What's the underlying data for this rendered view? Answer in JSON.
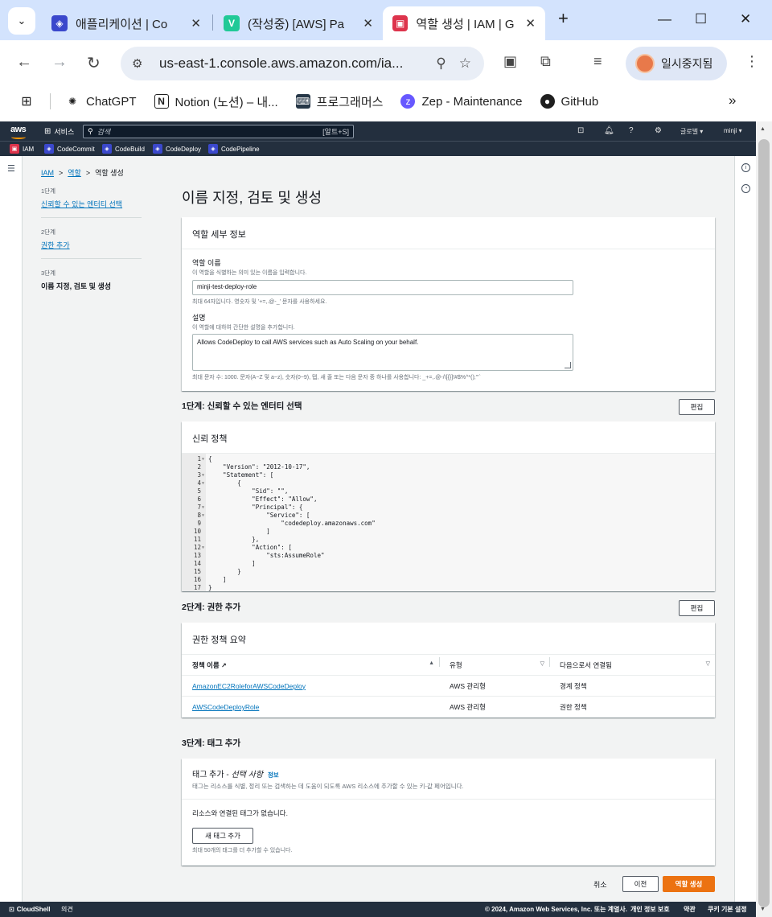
{
  "browser": {
    "tabs": [
      {
        "title": "애플리케이션 | Co",
        "favicon_color": "#3b48cc",
        "close": "✕"
      },
      {
        "title": "(작성중) [AWS] Pa",
        "favicon_color": "#20c997",
        "favicon_letter": "V",
        "close": "✕"
      },
      {
        "title": "역할 생성 | IAM | G",
        "favicon_color": "#dd344c",
        "close": "✕"
      }
    ],
    "new_tab": "+",
    "url": "us-east-1.console.aws.amazon.com/ia...",
    "profile_label": "일시중지됨",
    "bookmarks": [
      {
        "label": "ChatGPT"
      },
      {
        "label": "Notion (노션) – 내..."
      },
      {
        "label": "프로그래머스"
      },
      {
        "label": "Zep - Maintenance"
      },
      {
        "label": "GitHub"
      }
    ],
    "bookmarks_more": "»"
  },
  "aws": {
    "logo": "aws",
    "services_label": "서비스",
    "search_placeholder": "검색",
    "search_shortcut": "[알트+S]",
    "region": "글로벌 ▾",
    "account": "minji ▾",
    "favorites": [
      "IAM",
      "CodeCommit",
      "CodeBuild",
      "CodeDeploy",
      "CodePipeline"
    ]
  },
  "breadcrumb": {
    "items": [
      "IAM",
      "역할",
      "역할 생성"
    ],
    "sep": ">"
  },
  "steps": [
    {
      "num": "1단계",
      "label": "신뢰할 수 있는 엔터티 선택"
    },
    {
      "num": "2단계",
      "label": "권한 추가"
    },
    {
      "num": "3단계",
      "label": "이름 지정, 검토 및 생성"
    }
  ],
  "page_title": "이름 지정, 검토 및 생성",
  "role_details": {
    "heading": "역할 세부 정보",
    "name_label": "역할 이름",
    "name_desc": "이 역할을 식별하는 의미 있는 이름을 입력합니다.",
    "name_value": "minji-test-deploy-role",
    "name_hint": "최대 64자입니다. 영숫자 및 '+=,.@-_' 문자를 사용하세요.",
    "desc_label": "설명",
    "desc_desc": "이 역할에 대하여 간단한 설명을 추가합니다.",
    "desc_value": "Allows CodeDeploy to call AWS services such as Auto Scaling on your behalf.",
    "desc_hint": "최대 문자 수: 1000. 문자(A~Z 및 a~z), 숫자(0~9), 탭, 새 줄 또는 다음 문자 중 하나를 사용합니다: _+=,.@-/\\[{}]!#$%^*();'\"`"
  },
  "step1": {
    "title": "1단계: 신뢰할 수 있는 엔터티 선택",
    "edit": "편집",
    "panel_heading": "신뢰 정책",
    "code_lines": [
      {
        "n": "1",
        "fold": true,
        "t": "{"
      },
      {
        "n": "2",
        "fold": false,
        "t": "    \"Version\": \"2012-10-17\","
      },
      {
        "n": "3",
        "fold": true,
        "t": "    \"Statement\": ["
      },
      {
        "n": "4",
        "fold": true,
        "t": "        {"
      },
      {
        "n": "5",
        "fold": false,
        "t": "            \"Sid\": \"\","
      },
      {
        "n": "6",
        "fold": false,
        "t": "            \"Effect\": \"Allow\","
      },
      {
        "n": "7",
        "fold": true,
        "t": "            \"Principal\": {"
      },
      {
        "n": "8",
        "fold": true,
        "t": "                \"Service\": ["
      },
      {
        "n": "9",
        "fold": false,
        "t": "                    \"codedeploy.amazonaws.com\""
      },
      {
        "n": "10",
        "fold": false,
        "t": "                ]"
      },
      {
        "n": "11",
        "fold": false,
        "t": "            },"
      },
      {
        "n": "12",
        "fold": true,
        "t": "            \"Action\": ["
      },
      {
        "n": "13",
        "fold": false,
        "t": "                \"sts:AssumeRole\""
      },
      {
        "n": "14",
        "fold": false,
        "t": "            ]"
      },
      {
        "n": "15",
        "fold": false,
        "t": "        }"
      },
      {
        "n": "16",
        "fold": false,
        "t": "    ]"
      },
      {
        "n": "17",
        "fold": false,
        "t": "}"
      }
    ]
  },
  "step2": {
    "title": "2단계: 권한 추가",
    "edit": "편집",
    "panel_heading": "권한 정책 요약",
    "columns": [
      "정책 이름",
      "유형",
      "다음으로서 연결됨"
    ],
    "rows": [
      {
        "name": "AmazonEC2RoleforAWSCodeDeploy",
        "type": "AWS 관리형",
        "attached": "경계 정책"
      },
      {
        "name": "AWSCodeDeployRole",
        "type": "AWS 관리형",
        "attached": "권한 정책"
      }
    ]
  },
  "step3": {
    "title": "3단계: 태그 추가",
    "panel_heading": "태그 추가 - ",
    "panel_heading_optional": "선택 사항",
    "info": "정보",
    "panel_desc": "태그는 리소스를 식별, 정리 또는 검색하는 데 도움이 되도록 AWS 리소스에 추가할 수 있는 키-값 페어입니다.",
    "empty": "리소스와 연결된 태그가 없습니다.",
    "add_button": "새 태그 추가",
    "limit": "최대 50개의 태그를 더 추가할 수 있습니다."
  },
  "actions": {
    "cancel": "취소",
    "prev": "이전",
    "create": "역할 생성"
  },
  "footer": {
    "cloudshell": "CloudShell",
    "feedback": "의견",
    "copyright": "© 2024, Amazon Web Services, Inc. 또는 계열사.",
    "privacy": "개인 정보 보호",
    "terms": "약관",
    "cookies": "쿠키 기본 설정"
  }
}
